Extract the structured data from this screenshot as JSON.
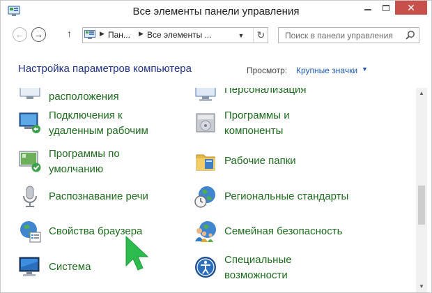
{
  "window": {
    "title": "Все элементы панели управления",
    "close_label": "✕"
  },
  "nav": {
    "back_glyph": "←",
    "forward_glyph": "→",
    "up_glyph": "↑",
    "breadcrumb": [
      "Пан...",
      "Все элементы ..."
    ],
    "address_dropdown_glyph": "▼",
    "refresh_glyph": "↻"
  },
  "search": {
    "placeholder": "Поиск в панели управления"
  },
  "header": {
    "title": "Настройка параметров компьютера",
    "view_label": "Просмотр:",
    "view_value": "Крупные значки",
    "view_caret": "▼"
  },
  "items": [
    {
      "lines": [
        "расположения"
      ],
      "icon": "location-icon"
    },
    {
      "lines": [
        "Персонализация"
      ],
      "icon": "personalization-icon"
    },
    {
      "lines": [
        "Подключения к",
        "удаленным рабочим"
      ],
      "icon": "remote-desktop-icon"
    },
    {
      "lines": [
        "Программы и",
        "компоненты"
      ],
      "icon": "programs-features-icon"
    },
    {
      "lines": [
        "Программы по",
        "умолчанию"
      ],
      "icon": "default-programs-icon"
    },
    {
      "lines": [
        "Рабочие папки"
      ],
      "icon": "work-folders-icon"
    },
    {
      "lines": [
        "Распознавание речи"
      ],
      "icon": "microphone-icon"
    },
    {
      "lines": [
        "Региональные стандарты"
      ],
      "icon": "region-clock-icon"
    },
    {
      "lines": [
        "Свойства браузера"
      ],
      "icon": "internet-options-icon"
    },
    {
      "lines": [
        "Семейная безопасность"
      ],
      "icon": "family-safety-icon"
    },
    {
      "lines": [
        "Система"
      ],
      "icon": "system-icon"
    },
    {
      "lines": [
        "Специальные",
        "возможности"
      ],
      "icon": "ease-of-access-icon"
    }
  ],
  "colors": {
    "link_green": "#1d6b1d",
    "title_blue": "#1e3287",
    "accent_blue": "#1e5ab4",
    "close_red": "#c7504b",
    "pointer_green": "#2dbb4e"
  }
}
